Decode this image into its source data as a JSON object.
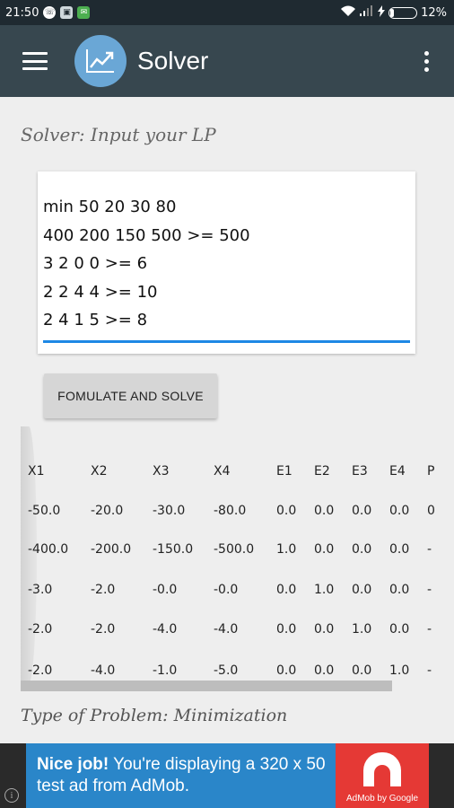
{
  "status_bar": {
    "time": "21:50",
    "battery": "12%",
    "battery_level": 0.12,
    "notification_icons": [
      "whatsapp-icon",
      "screen-icon",
      "message-icon"
    ]
  },
  "toolbar": {
    "title": "Solver",
    "menu_icon": "hamburger-icon",
    "logo_icon": "chart-trend-icon",
    "overflow_icon": "more-vert-icon",
    "color": "#37474f"
  },
  "heading": "Solver: Input your LP",
  "lp_input": {
    "lines": [
      "min 50 20 30 80",
      "400 200 150 500 >= 500",
      "3 2 0 0 >= 6",
      "2 2 4 4 >= 10",
      "2 4 1 5 >= 8"
    ],
    "underline_color": "#1e88e5"
  },
  "solve_button": "FOMULATE AND SOLVE",
  "table": {
    "headers": [
      "X1",
      "X2",
      "X3",
      "X4",
      "E1",
      "E2",
      "E3",
      "E4",
      "P"
    ],
    "rows": [
      [
        "-50.0",
        "-20.0",
        "-30.0",
        "-80.0",
        "0.0",
        "0.0",
        "0.0",
        "0.0",
        "0"
      ],
      [
        "-400.0",
        "-200.0",
        "-150.0",
        "-500.0",
        "1.0",
        "0.0",
        "0.0",
        "0.0",
        "-"
      ],
      [
        "-3.0",
        "-2.0",
        "-0.0",
        "-0.0",
        "0.0",
        "1.0",
        "0.0",
        "0.0",
        "-"
      ],
      [
        "-2.0",
        "-2.0",
        "-4.0",
        "-4.0",
        "0.0",
        "0.0",
        "1.0",
        "0.0",
        "-"
      ],
      [
        "-2.0",
        "-4.0",
        "-1.0",
        "-5.0",
        "0.0",
        "0.0",
        "0.0",
        "1.0",
        "-"
      ]
    ]
  },
  "problem_type": "Type of Problem: Minimization",
  "ad": {
    "bold": "Nice job!",
    "text": " You're displaying a 320 x 50 test ad from AdMob.",
    "brand": "AdMob by Google",
    "info_icon": "info-icon"
  }
}
